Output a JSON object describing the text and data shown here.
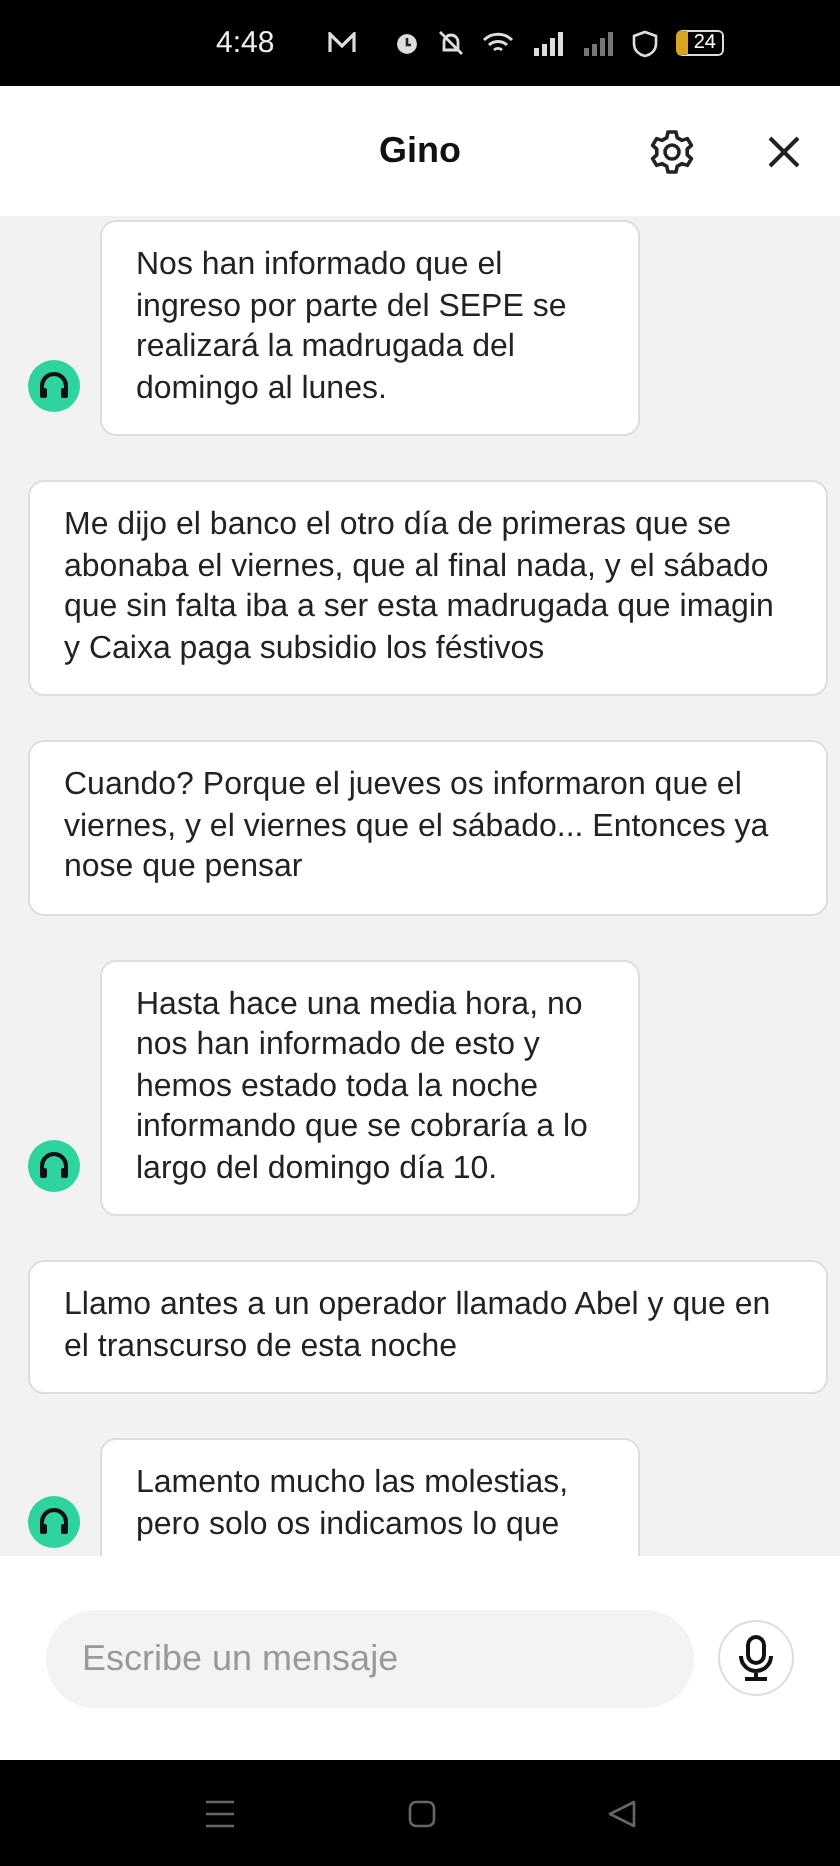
{
  "status_bar": {
    "time": "4:48",
    "battery": "24"
  },
  "header": {
    "title": "Gino"
  },
  "messages": [
    {
      "kind": "agent",
      "text": "Nos han informado que el ingreso por parte del SEPE se realizará la madrugada del domingo al lunes."
    },
    {
      "kind": "user",
      "text": "Me dijo el banco el otro día de primeras que se abonaba el viernes, que al final nada, y el sábado que sin falta iba a ser esta madrugada que imagin y Caixa paga subsidio los féstivos"
    },
    {
      "kind": "user",
      "text": "Cuando? Porque el jueves os informaron que el viernes, y el viernes que el sábado... Entonces ya nose que pensar"
    },
    {
      "kind": "agent",
      "text": "Hasta hace una media hora, no nos han informado de esto y hemos estado toda la noche informando que se cobraría a lo largo del domingo día 10."
    },
    {
      "kind": "user",
      "text": "Llamo antes a un operador llamado Abel y que en el transcurso de esta noche"
    },
    {
      "kind": "agent",
      "text": "Lamento mucho las molestias, pero solo os indicamos lo que"
    }
  ],
  "composer": {
    "placeholder": "Escribe un mensaje"
  }
}
